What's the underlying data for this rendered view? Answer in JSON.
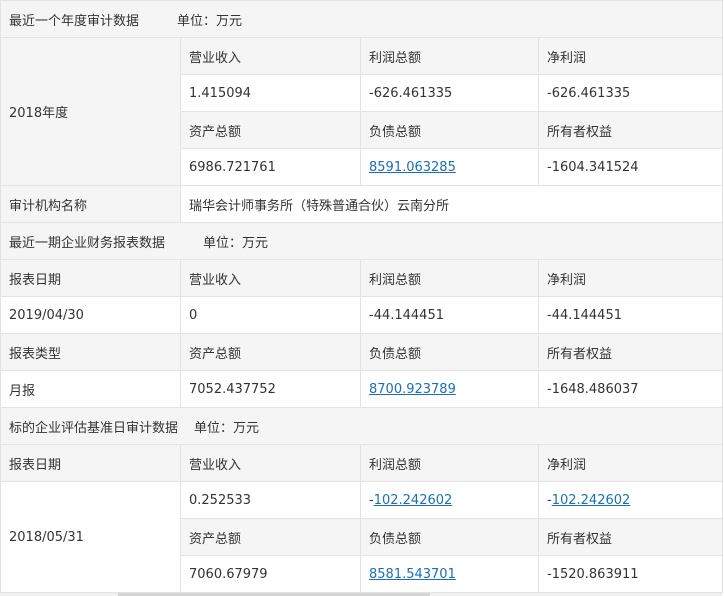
{
  "annual": {
    "title": "最近一个年度审计数据",
    "unit": "单位：万元",
    "year": "2018年度",
    "row1_labels": [
      "营业收入",
      "利润总额",
      "净利润"
    ],
    "row1_values": [
      "1.415094",
      "-626.461335",
      "-626.461335"
    ],
    "row2_labels": [
      "资产总额",
      "负债总额",
      "所有者权益"
    ],
    "row2_values": [
      "6986.721761",
      "8591.063285",
      "-1604.341524"
    ],
    "auditor_label": "审计机构名称",
    "auditor_name": "瑞华会计师事务所（特殊普通合伙）云南分所"
  },
  "recent": {
    "title": "最近一期企业财务报表数据",
    "unit": "单位：万元",
    "date_label": "报表日期",
    "row1_labels": [
      "营业收入",
      "利润总额",
      "净利润"
    ],
    "date_value": "2019/04/30",
    "row1_values": [
      "0",
      "-44.144451",
      "-44.144451"
    ],
    "type_label": "报表类型",
    "row2_labels": [
      "资产总额",
      "负债总额",
      "所有者权益"
    ],
    "type_value": "月报",
    "row2_values": [
      "7052.437752",
      "8700.923789",
      "-1648.486037"
    ]
  },
  "benchmark": {
    "title": "标的企业评估基准日审计数据",
    "unit": "单位：万元",
    "date_label": "报表日期",
    "row1_labels": [
      "营业收入",
      "利润总额",
      "净利润"
    ],
    "date_value": "2018/05/31",
    "row1_values": [
      "0.252533",
      "102.242602",
      "102.242602"
    ],
    "minus_sign": "-",
    "row2_labels": [
      "资产总额",
      "负债总额",
      "所有者权益"
    ],
    "row2_values": [
      "7060.67979",
      "8581.543701",
      "-1520.863911"
    ]
  }
}
